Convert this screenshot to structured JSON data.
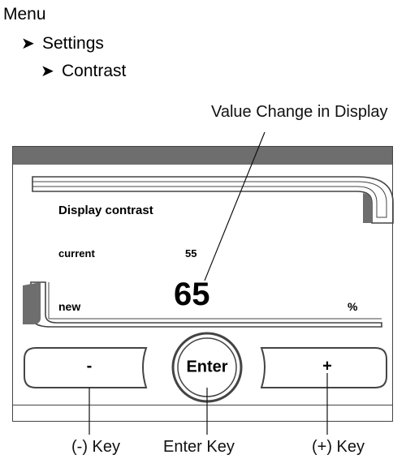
{
  "breadcrumb": {
    "root": "Menu",
    "level1": "Settings",
    "level2": "Contrast",
    "arrow_glyph": "➤"
  },
  "callouts": {
    "display_value_change": "Value Change in Display",
    "minus_key": "(-) Key",
    "enter_key": "Enter Key",
    "plus_key": "(+) Key"
  },
  "screen": {
    "title": "Display contrast",
    "current_label": "current",
    "current_value": "55",
    "new_label": "new",
    "new_value": "65",
    "unit": "%"
  },
  "keys": {
    "minus": "-",
    "enter": "Enter",
    "plus": "+"
  },
  "colors": {
    "title_bar": "#6e6e6e",
    "frame": "#444444"
  }
}
